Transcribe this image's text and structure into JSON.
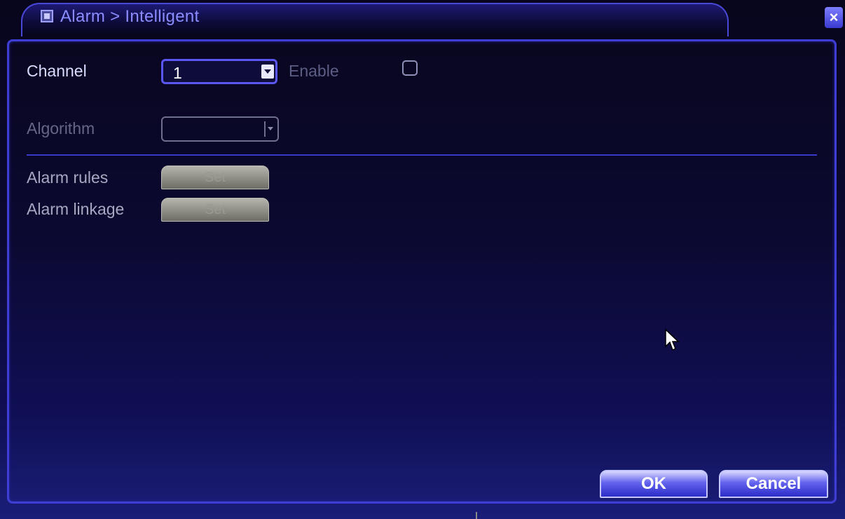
{
  "window": {
    "title": "Alarm > Intelligent",
    "close_symbol": "×",
    "title_icon": "window-icon"
  },
  "form": {
    "channel_label": "Channel",
    "channel_value": "1",
    "enable_label": "Enable",
    "enable_checked": false,
    "algorithm_label": "Algorithm",
    "algorithm_value": "",
    "alarm_rules_label": "Alarm rules",
    "alarm_rules_button": "Set",
    "alarm_linkage_label": "Alarm linkage",
    "alarm_linkage_button": "Set"
  },
  "buttons": {
    "ok": "OK",
    "cancel": "Cancel"
  },
  "colors": {
    "accent": "#4a48d8",
    "title_text": "#8b8cff",
    "background_dark": "#08061c",
    "button_blue": "#6363ef"
  }
}
